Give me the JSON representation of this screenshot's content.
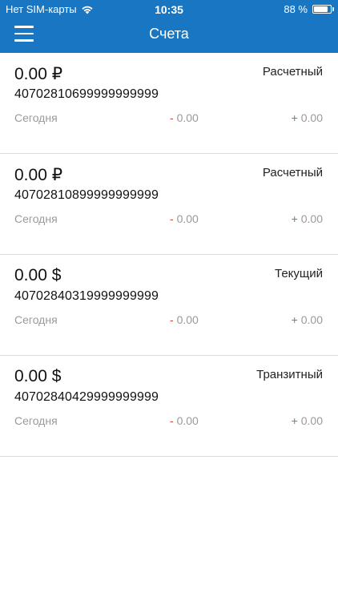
{
  "status_bar": {
    "carrier": "Нет SIM-карты",
    "time": "10:35",
    "battery": "88 %"
  },
  "nav": {
    "title": "Счета",
    "menu_icon": "hamburger-menu-icon"
  },
  "colors": {
    "primary": "#1976c2",
    "debit_sign": "#e53935",
    "credit_sign": "#43a047",
    "muted_text": "#9a9a9a"
  },
  "accounts": [
    {
      "balance": "0.00 ₽",
      "type": "Расчетный",
      "number": "40702810699999999999",
      "date": "Сегодня",
      "debit_sign": "-",
      "debit": "0.00",
      "credit_sign": "+",
      "credit": "0.00"
    },
    {
      "balance": "0.00 ₽",
      "type": "Расчетный",
      "number": "40702810899999999999",
      "date": "Сегодня",
      "debit_sign": "-",
      "debit": "0.00",
      "credit_sign": "+",
      "credit": "0.00"
    },
    {
      "balance": "0.00 $",
      "type": "Текущий",
      "number": "40702840319999999999",
      "date": "Сегодня",
      "debit_sign": "-",
      "debit": "0.00",
      "credit_sign": "+",
      "credit": "0.00"
    },
    {
      "balance": "0.00 $",
      "type": "Транзитный",
      "number": "40702840429999999999",
      "date": "Сегодня",
      "debit_sign": "-",
      "debit": "0.00",
      "credit_sign": "+",
      "credit": "0.00"
    }
  ]
}
